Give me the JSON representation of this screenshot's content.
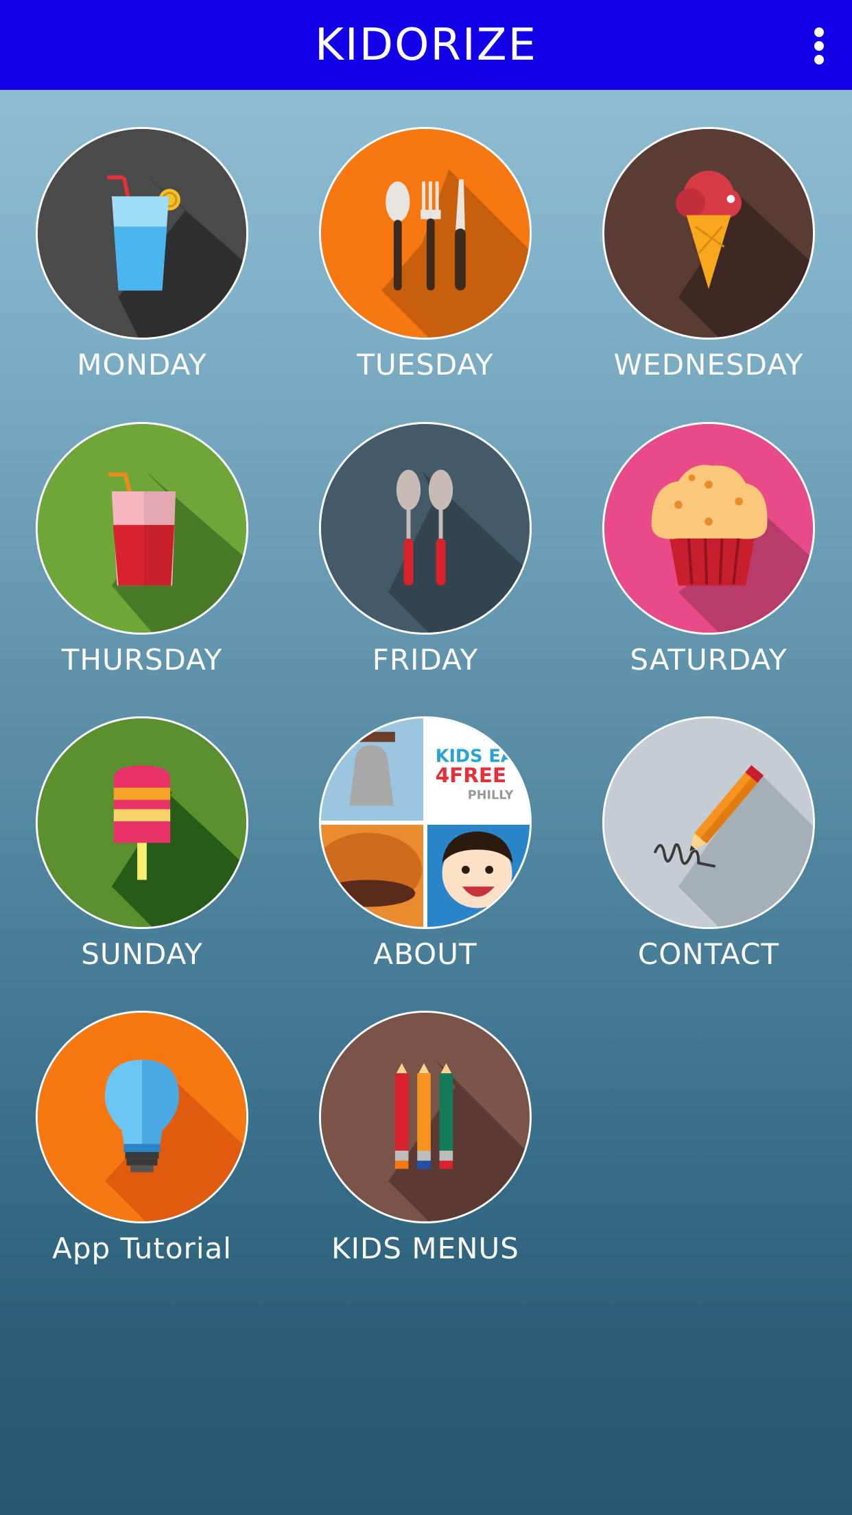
{
  "app": {
    "title": "KIDORIZE",
    "overflow_icon": "more-vert-icon"
  },
  "theme": {
    "appbar_color": "#1200e6"
  },
  "tiles": [
    {
      "label": "MONDAY",
      "icon": "drink-cup-icon",
      "color": "#3f3f3f"
    },
    {
      "label": "TUESDAY",
      "icon": "utensils-icon",
      "color": "#f77810"
    },
    {
      "label": "WEDNESDAY",
      "icon": "ice-cream-cone-icon",
      "color": "#5a3c34"
    },
    {
      "label": "THURSDAY",
      "icon": "soda-cup-icon",
      "color": "#6ea637"
    },
    {
      "label": "FRIDAY",
      "icon": "spoons-icon",
      "color": "#455a68"
    },
    {
      "label": "SATURDAY",
      "icon": "muffin-icon",
      "color": "#e94b88"
    },
    {
      "label": "SUNDAY",
      "icon": "popsicle-icon",
      "color": "#5a912e"
    },
    {
      "label": "ABOUT",
      "icon": "about-collage-image",
      "color": "#ffffff",
      "image_text": [
        "KIDS EAT",
        "4FREE",
        "PHILLY"
      ]
    },
    {
      "label": "CONTACT",
      "icon": "pencil-signature-icon",
      "color": "#c5cdd3"
    },
    {
      "label": "App Tutorial",
      "icon": "lightbulb-icon",
      "color": "#f77810"
    },
    {
      "label": "KIDS MENUS",
      "icon": "colored-pencils-icon",
      "color": "#7a5448"
    }
  ]
}
